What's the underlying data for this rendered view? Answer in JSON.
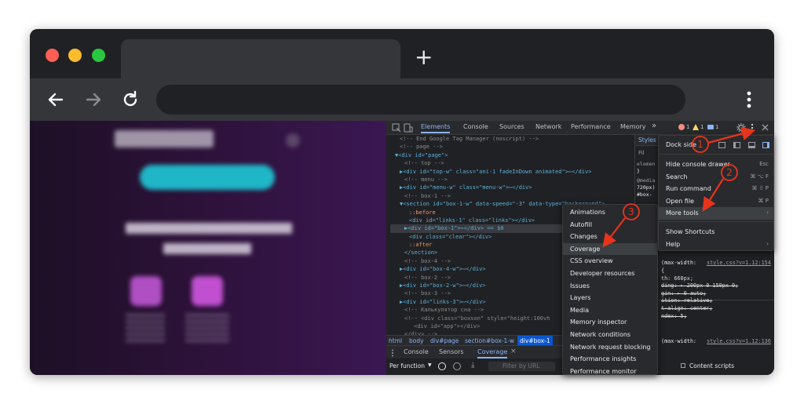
{
  "browser": {
    "new_tab_symbol": "+",
    "colors": {
      "close": "#ff5f57",
      "minimize": "#febc2e",
      "maximize": "#28c840"
    }
  },
  "devtools": {
    "tabs": [
      "Elements",
      "Console",
      "Sources",
      "Network",
      "Performance",
      "Memory"
    ],
    "more_tabs": "»",
    "errors": "1",
    "warnings": "1",
    "messages": "1",
    "code_lines": [
      {
        "text": "<!-- End Google Tag Manager (noscript) -->",
        "kind": "cmt",
        "indent": 2
      },
      {
        "text": "<!-- page -->",
        "kind": "cmt",
        "indent": 2
      },
      {
        "text": "▼<div id=\"page\">",
        "kind": "tag",
        "indent": 1
      },
      {
        "text": "<!-- top -->",
        "kind": "cmt",
        "indent": 3
      },
      {
        "text": "▶<div id=\"top-w\" class=\"ani-1 fadeInDown animated\">⋯</div>",
        "kind": "tag",
        "indent": 2
      },
      {
        "text": "<!-- menu -->",
        "kind": "cmt",
        "indent": 3
      },
      {
        "text": "▶<div id=\"menu-w\" class=\"menu-w\">⋯</div>",
        "kind": "tag",
        "indent": 2
      },
      {
        "text": "<!-- box-1 -->",
        "kind": "cmt",
        "indent": 3
      },
      {
        "text": "▼<section id=\"box-1-w\" data-speed=\"-3\" data-type=\"background\">",
        "kind": "tag",
        "indent": 2
      },
      {
        "text": "::before",
        "kind": "val",
        "indent": 4
      },
      {
        "text": "<div id=\"links-1\" class=\"links\"></div>",
        "kind": "tag",
        "indent": 4
      },
      {
        "text": "▶<div id=\"box-1\">⋯</div> == $0",
        "kind": "sel",
        "indent": 3
      },
      {
        "text": "<div class=\"clear\"></div>",
        "kind": "tag",
        "indent": 4
      },
      {
        "text": "::after",
        "kind": "val",
        "indent": 4
      },
      {
        "text": "</section>",
        "kind": "tag",
        "indent": 3
      },
      {
        "text": "<!-- box-4 -->",
        "kind": "cmt",
        "indent": 3
      },
      {
        "text": "▶<div id=\"box-4-w\">⋯</div>",
        "kind": "tag",
        "indent": 2
      },
      {
        "text": "<!-- box-2 -->",
        "kind": "cmt",
        "indent": 3
      },
      {
        "text": "▶<div id=\"box-2-w\">⋯</div>",
        "kind": "tag",
        "indent": 2
      },
      {
        "text": "<!-- box-3 -->",
        "kind": "cmt",
        "indent": 3
      },
      {
        "text": "▶<div id=\"links-3\">⋯</div>",
        "kind": "tag",
        "indent": 2
      },
      {
        "text": "<!-- Калькулятор сна -->",
        "kind": "cmt",
        "indent": 3
      },
      {
        "text": "<!-- <div class=\"boxson\" style=\"height:100vh",
        "kind": "cmt",
        "indent": 3
      },
      {
        "text": "<div id=\"app\"></div>",
        "kind": "cmt",
        "indent": 5
      },
      {
        "text": "</div> -->",
        "kind": "cmt",
        "indent": 3
      }
    ],
    "breadcrumbs": [
      "html",
      "body",
      "div#page",
      "section#box-1-w",
      "div#box-1"
    ],
    "styles": {
      "tab": "Styles",
      "filter": "Fil",
      "element_label": "elemen",
      "media_label": "@media",
      "media_value": "720px)",
      "selector": "#box-",
      "rule1_header": "(max-width:",
      "rule1_link": "style.css?v=1.12:154",
      "rule1_lines": [
        "{",
        "th: 660px;",
        "ding: ▸ 200px 0 150px 0;",
        "gin: ▸ 0 auto;",
        "ition: relative;",
        "t-align: center;",
        "ndex: 5;"
      ],
      "rule2_header": "(max-width:",
      "rule2_link": "style.css?v=1.12:136"
    },
    "drawer_tabs": [
      "Console",
      "Sensors",
      "Coverage"
    ],
    "drawer_toolbar": {
      "per_function": "Per function",
      "filter_placeholder": "Filter by URL",
      "content_scripts": "Content scripts"
    }
  },
  "main_menu": {
    "dock_side": "Dock side",
    "items": [
      {
        "label": "Hide console drawer",
        "shortcut": "Esc"
      },
      {
        "label": "Search",
        "shortcut": "⌘ ⌥ F"
      },
      {
        "label": "Run command",
        "shortcut": "⌘ ⇧ P"
      },
      {
        "label": "Open file",
        "shortcut": "⌘ P"
      },
      {
        "label": "More tools",
        "shortcut": "›"
      },
      {
        "label": "Show Shortcuts",
        "shortcut": ""
      },
      {
        "label": "Help",
        "shortcut": "›"
      }
    ]
  },
  "more_tools_menu": {
    "items": [
      "Animations",
      "Autofill",
      "Changes",
      "Coverage",
      "CSS overview",
      "Developer resources",
      "Issues",
      "Layers",
      "Media",
      "Memory inspector",
      "Network conditions",
      "Network request blocking",
      "Performance insights",
      "Performance monitor"
    ]
  },
  "annotations": {
    "step1": "1",
    "step2": "2",
    "step3": "3",
    "arrow_color": "#e8341c"
  }
}
